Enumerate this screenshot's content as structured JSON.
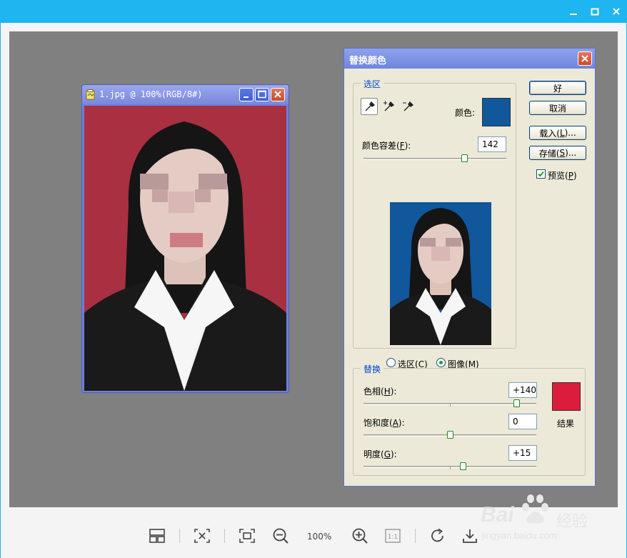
{
  "viewer": {
    "window_buttons": [
      "minimize-icon",
      "maximize-icon",
      "close-icon"
    ],
    "zoom_label": "100%",
    "toolbar_icons": [
      "thumbnails-icon",
      "fit-icon",
      "fullscreen-icon",
      "zoom-out-icon",
      "zoom-in-icon",
      "actual-size-icon",
      "rotate-icon",
      "download-icon"
    ],
    "actual_size_label": "1:1",
    "accent": "#1eb5f0"
  },
  "document": {
    "title": "1.jpg @ 100%(RGB/8#)",
    "background_color": "#a93040"
  },
  "dialog": {
    "title": "替换颜色",
    "selection_group": "选区",
    "color_label": "颜色:",
    "selected_color": "#10579c",
    "fuzziness_label": "颜色容差(",
    "fuzziness_key": "F",
    "fuzziness_tail": "):",
    "fuzziness_value": "142",
    "fuzziness_fraction": 0.71,
    "radio_selection": "选区(",
    "radio_selection_key": "C",
    "radio_image": "图像(",
    "radio_image_key": "M",
    "radio_close": ")",
    "ok_button": "好",
    "cancel_button": "取消",
    "load_button_text": "载入(",
    "load_button_key": "L",
    "load_button_tail": ")...",
    "save_button_text": "存储(",
    "save_button_key": "S",
    "save_button_tail": ")...",
    "preview_label": "预览(",
    "preview_key": "P",
    "preview_tail": ")",
    "preview_checked": true,
    "replace_group": "替换",
    "hue_label": "色相(",
    "hue_key": "H",
    "hue_tail": "):",
    "hue_value": "+140",
    "saturation_label": "饱和度(",
    "saturation_key": "A",
    "saturation_tail": "):",
    "saturation_value": "0",
    "lightness_label": "明度(",
    "lightness_key": "G",
    "lightness_tail": "):",
    "lightness_value": "+15",
    "result_label": "结果",
    "result_color": "#dc1c3c"
  },
  "watermark": {
    "brand": "Bai",
    "brand_tail": "经验",
    "url": "jingyan.baidu.com"
  }
}
